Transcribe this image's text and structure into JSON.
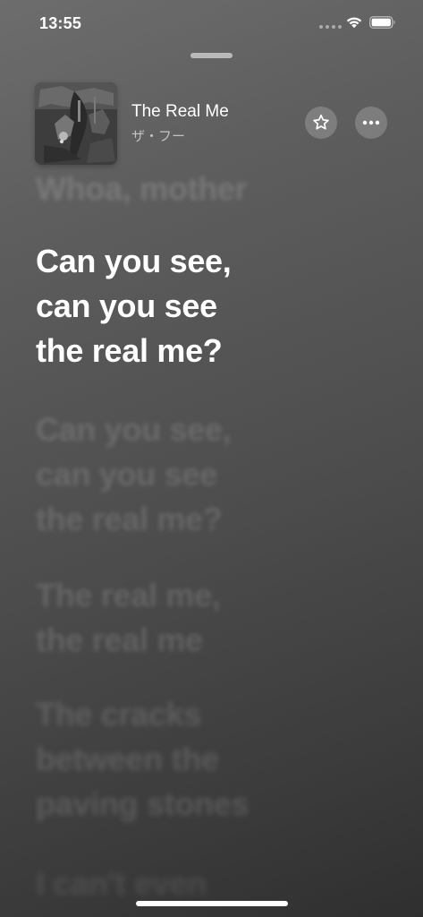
{
  "status_bar": {
    "time": "13:55",
    "icons": [
      "signal-dots-icon",
      "wifi-icon",
      "battery-icon"
    ]
  },
  "now_playing": {
    "title": "The Real Me",
    "artist": "ザ・フー",
    "album_art": "album-artwork"
  },
  "controls": {
    "favorite_icon": "star-icon",
    "more_icon": "ellipsis-icon"
  },
  "lyrics": {
    "previous": [
      "Whoa, mother"
    ],
    "current": [
      "Can you see,",
      "can you see",
      "the real me?"
    ],
    "upcoming": [
      [
        "Can you see,",
        "can you see",
        "the real me?"
      ],
      [
        "The real me,",
        "the real me"
      ],
      [
        "The cracks",
        "between the",
        "paving stones"
      ],
      [
        "I can't even"
      ]
    ]
  },
  "colors": {
    "background_top": "#6d6d6d",
    "background_bottom": "#2f2f2f",
    "active_lyric": "#ffffff"
  }
}
